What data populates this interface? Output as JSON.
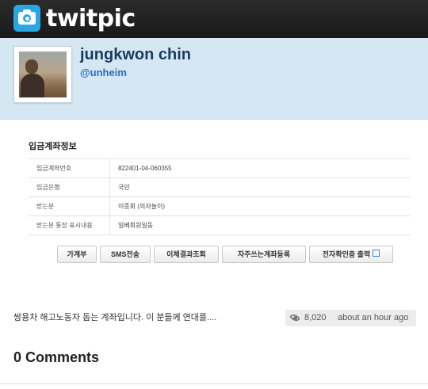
{
  "header": {
    "logo_text": "twitpic",
    "logo_icon": "camera-icon",
    "brand_color": "#2aa6e3"
  },
  "profile": {
    "display_name": "jungkwon chin",
    "handle": "@unheim"
  },
  "account_info": {
    "title": "입금계좌정보",
    "rows": [
      {
        "label": "입금계좌번호",
        "value": "822401-04-060355"
      },
      {
        "label": "입금은행",
        "value": "국민"
      },
      {
        "label": "받는분",
        "value": "이종회 (의자놀이)"
      },
      {
        "label": "받는분 통장 표시내용",
        "value": "일베회원일동"
      }
    ],
    "buttons": [
      {
        "label": "가계부"
      },
      {
        "label": "SMS전송"
      },
      {
        "label": "이체결과조회"
      },
      {
        "label": "자주쓰는계좌등록"
      },
      {
        "label": "전자확인증 출력"
      }
    ]
  },
  "photo": {
    "caption": "쌍용차 해고노동자 돕는 계좌입니다. 이 분들께 연대를....",
    "views": "8,020",
    "views_icon": "eye-icon",
    "timestamp": "about an hour ago"
  },
  "comments": {
    "title": "0 Comments"
  }
}
